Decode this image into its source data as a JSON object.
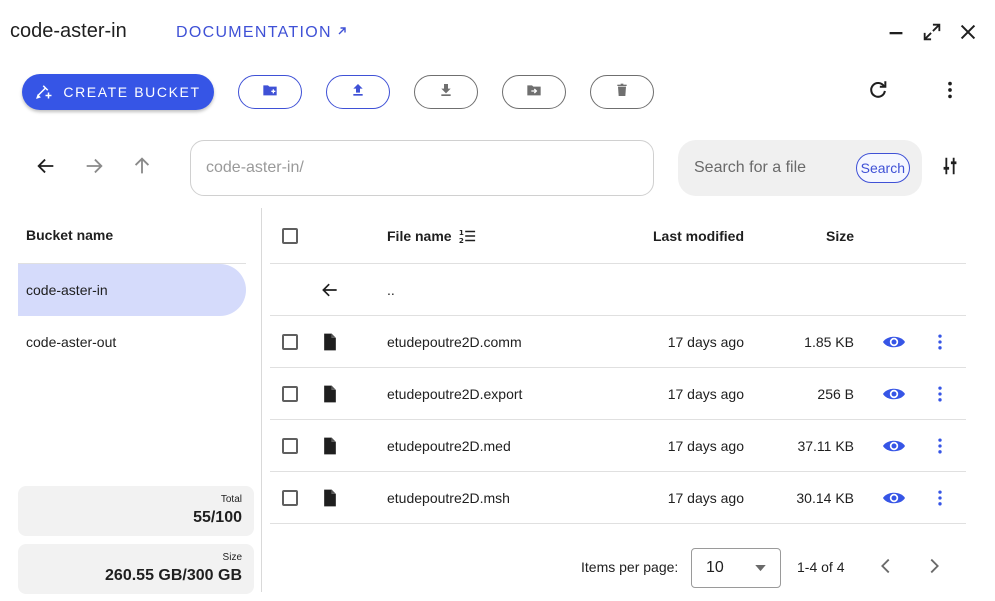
{
  "header": {
    "title": "code-aster-in",
    "doc_link": "DOCUMENTATION"
  },
  "toolbar": {
    "create_bucket": "CREATE BUCKET",
    "buttons": [
      "new-folder",
      "upload",
      "download",
      "move",
      "delete"
    ]
  },
  "nav": {
    "path": "code-aster-in/",
    "search_placeholder": "Search for a file",
    "search_button": "Search"
  },
  "buckets": {
    "header": "Bucket name",
    "items": [
      {
        "name": "code-aster-in",
        "selected": true
      },
      {
        "name": "code-aster-out",
        "selected": false
      }
    ],
    "total_label": "Total",
    "total_value": "55/100",
    "size_label": "Size",
    "size_value": "260.55 GB/300 GB"
  },
  "files": {
    "columns": {
      "name": "File name",
      "modified": "Last modified",
      "size": "Size"
    },
    "parent": "..",
    "rows": [
      {
        "name": "etudepoutre2D.comm",
        "modified": "17 days ago",
        "size": "1.85 KB"
      },
      {
        "name": "etudepoutre2D.export",
        "modified": "17 days ago",
        "size": "256 B"
      },
      {
        "name": "etudepoutre2D.med",
        "modified": "17 days ago",
        "size": "37.11 KB"
      },
      {
        "name": "etudepoutre2D.msh",
        "modified": "17 days ago",
        "size": "30.14 KB"
      }
    ]
  },
  "pager": {
    "items_per_page_label": "Items per page:",
    "items_per_page": "10",
    "range": "1-4 of 4"
  },
  "colors": {
    "accent": "#3655e6",
    "selected_bg": "#d5dbfb"
  }
}
